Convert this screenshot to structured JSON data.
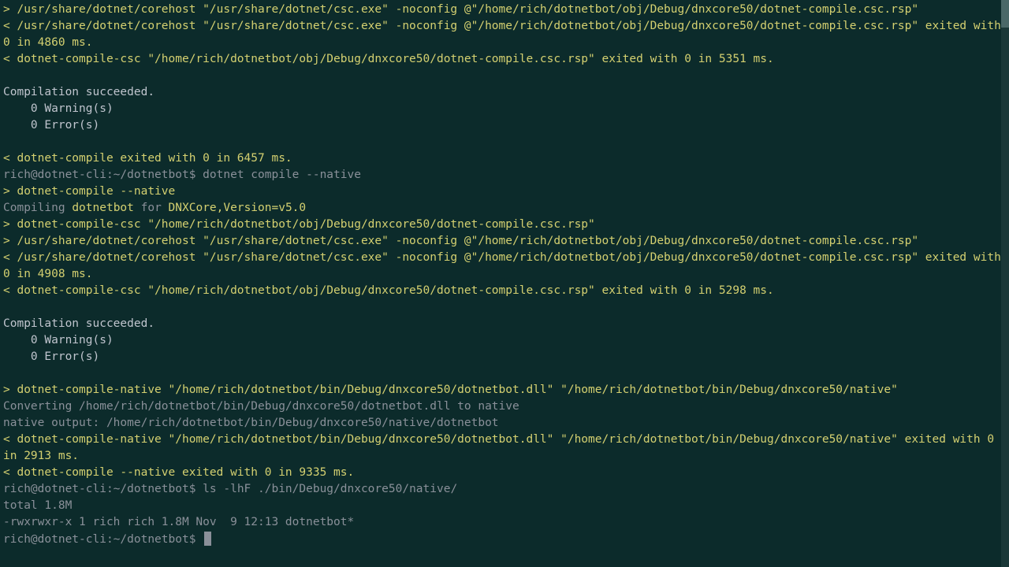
{
  "colors": {
    "bg": "#0c2b2b",
    "yellow": "#d4d070",
    "gray": "#8a9099",
    "text": "#c0c5ce"
  },
  "lines": [
    {
      "cls": "yellow",
      "text": "> /usr/share/dotnet/corehost \"/usr/share/dotnet/csc.exe\" -noconfig @\"/home/rich/dotnetbot/obj/Debug/dnxcore50/dotnet-compile.csc.rsp\""
    },
    {
      "cls": "yellow",
      "text": "< /usr/share/dotnet/corehost \"/usr/share/dotnet/csc.exe\" -noconfig @\"/home/rich/dotnetbot/obj/Debug/dnxcore50/dotnet-compile.csc.rsp\" exited with 0 in 4860 ms."
    },
    {
      "cls": "yellow",
      "text": "< dotnet-compile-csc \"/home/rich/dotnetbot/obj/Debug/dnxcore50/dotnet-compile.csc.rsp\" exited with 0 in 5351 ms."
    },
    {
      "cls": "empty",
      "text": ""
    },
    {
      "cls": "white",
      "text": "Compilation succeeded."
    },
    {
      "cls": "white",
      "text": "    0 Warning(s)"
    },
    {
      "cls": "white",
      "text": "    0 Error(s)"
    },
    {
      "cls": "empty",
      "text": ""
    },
    {
      "cls": "yellow",
      "text": "< dotnet-compile exited with 0 in 6457 ms."
    }
  ],
  "prompt1": {
    "ps1": "rich@dotnet-cli:~/dotnetbot$ ",
    "cmd": "dotnet compile --native"
  },
  "lines2": [
    {
      "cls": "yellow",
      "text": "> dotnet-compile --native"
    }
  ],
  "compiling": {
    "pre": "Compiling ",
    "name": "dotnetbot",
    "mid": " for ",
    "target": "DNXCore,Version=v5.0"
  },
  "lines3": [
    {
      "cls": "yellow",
      "text": "> dotnet-compile-csc \"/home/rich/dotnetbot/obj/Debug/dnxcore50/dotnet-compile.csc.rsp\""
    },
    {
      "cls": "yellow",
      "text": "> /usr/share/dotnet/corehost \"/usr/share/dotnet/csc.exe\" -noconfig @\"/home/rich/dotnetbot/obj/Debug/dnxcore50/dotnet-compile.csc.rsp\""
    },
    {
      "cls": "yellow",
      "text": "< /usr/share/dotnet/corehost \"/usr/share/dotnet/csc.exe\" -noconfig @\"/home/rich/dotnetbot/obj/Debug/dnxcore50/dotnet-compile.csc.rsp\" exited with 0 in 4908 ms."
    },
    {
      "cls": "yellow",
      "text": "< dotnet-compile-csc \"/home/rich/dotnetbot/obj/Debug/dnxcore50/dotnet-compile.csc.rsp\" exited with 0 in 5298 ms."
    },
    {
      "cls": "empty",
      "text": ""
    },
    {
      "cls": "white",
      "text": "Compilation succeeded."
    },
    {
      "cls": "white",
      "text": "    0 Warning(s)"
    },
    {
      "cls": "white",
      "text": "    0 Error(s)"
    },
    {
      "cls": "empty",
      "text": ""
    },
    {
      "cls": "yellow",
      "text": "> dotnet-compile-native \"/home/rich/dotnetbot/bin/Debug/dnxcore50/dotnetbot.dll\" \"/home/rich/dotnetbot/bin/Debug/dnxcore50/native\""
    },
    {
      "cls": "gray",
      "text": "Converting /home/rich/dotnetbot/bin/Debug/dnxcore50/dotnetbot.dll to native"
    },
    {
      "cls": "gray",
      "text": "native output: /home/rich/dotnetbot/bin/Debug/dnxcore50/native/dotnetbot"
    },
    {
      "cls": "yellow",
      "text": "< dotnet-compile-native \"/home/rich/dotnetbot/bin/Debug/dnxcore50/dotnetbot.dll\" \"/home/rich/dotnetbot/bin/Debug/dnxcore50/native\" exited with 0 in 2913 ms."
    },
    {
      "cls": "yellow",
      "text": "< dotnet-compile --native exited with 0 in 9335 ms."
    }
  ],
  "prompt2": {
    "ps1": "rich@dotnet-cli:~/dotnetbot$ ",
    "cmd": "ls -lhF ./bin/Debug/dnxcore50/native/"
  },
  "lines4": [
    {
      "cls": "gray",
      "text": "total 1.8M"
    },
    {
      "cls": "gray",
      "text": "-rwxrwxr-x 1 rich rich 1.8M Nov  9 12:13 dotnetbot*"
    }
  ],
  "prompt3": {
    "ps1": "rich@dotnet-cli:~/dotnetbot$ ",
    "cmd": ""
  }
}
